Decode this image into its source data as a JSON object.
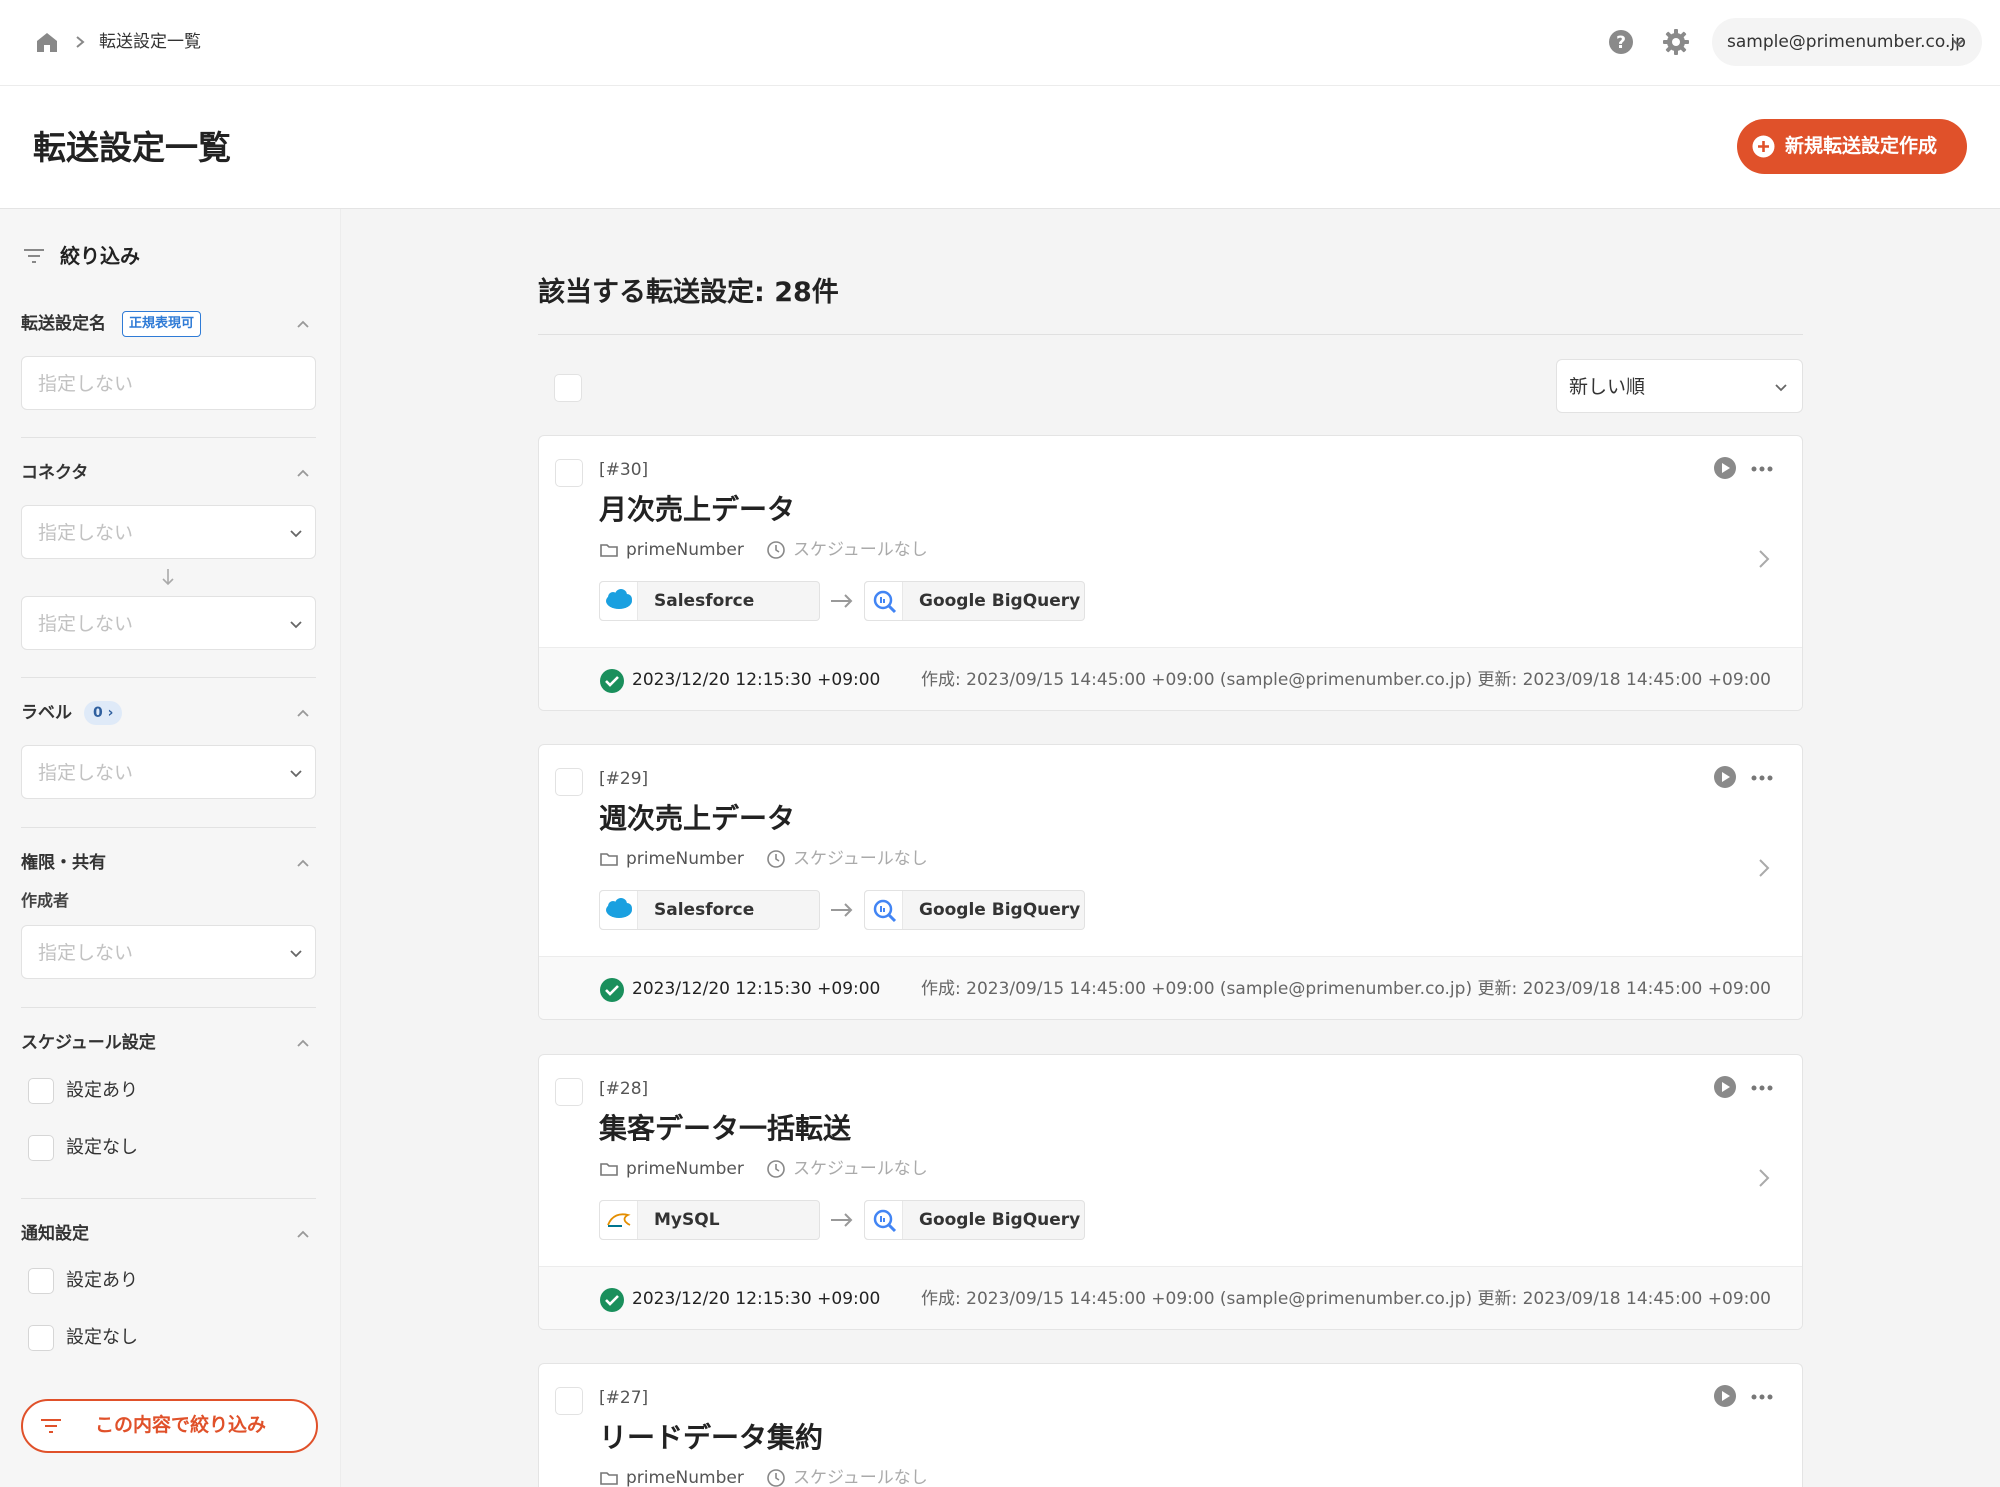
{
  "header": {
    "breadcrumb_current": "転送設定一覧",
    "account_email": "sample@primenumber.co.jp"
  },
  "page": {
    "title": "転送設定一覧",
    "create_button": "新規転送設定作成"
  },
  "sidebar": {
    "filter_label": "絞り込み",
    "sections": {
      "name": {
        "title": "転送設定名",
        "badge": "正規表現可",
        "placeholder": "指定しない"
      },
      "connector": {
        "title": "コネクタ",
        "source_value": "指定しない",
        "destination_value": "指定しない"
      },
      "label": {
        "title": "ラベル",
        "count_badge": "0 ›",
        "value": "指定しない"
      },
      "permission": {
        "title": "権限・共有",
        "creator_label": "作成者",
        "creator_value": "指定しない"
      },
      "schedule": {
        "title": "スケジュール設定",
        "option_on": "設定あり",
        "option_off": "設定なし"
      },
      "notification": {
        "title": "通知設定",
        "option_on": "設定あり",
        "option_off": "設定なし"
      }
    },
    "apply_button": "この内容で絞り込み"
  },
  "main": {
    "result_count": "該当する転送設定: 28件",
    "sort_value": "新しい順",
    "cards": [
      {
        "id": "[#30]",
        "title": "月次売上データ",
        "folder": "primeNumber",
        "schedule": "スケジュールなし",
        "source": "Salesforce",
        "source_icon": "salesforce-logo",
        "destination": "Google BigQuery",
        "destination_icon": "bigquery-logo",
        "last_run": "2023/12/20 12:15:30 +09:00",
        "meta": "作成: 2023/09/15 14:45:00 +09:00 (sample@primenumber.co.jp)   更新: 2023/09/18 14:45:00 +09:00"
      },
      {
        "id": "[#29]",
        "title": "週次売上データ",
        "folder": "primeNumber",
        "schedule": "スケジュールなし",
        "source": "Salesforce",
        "source_icon": "salesforce-logo",
        "destination": "Google BigQuery",
        "destination_icon": "bigquery-logo",
        "last_run": "2023/12/20 12:15:30 +09:00",
        "meta": "作成: 2023/09/15 14:45:00 +09:00 (sample@primenumber.co.jp)   更新: 2023/09/18 14:45:00 +09:00"
      },
      {
        "id": "[#28]",
        "title": "集客データ一括転送",
        "folder": "primeNumber",
        "schedule": "スケジュールなし",
        "source": "MySQL",
        "source_icon": "mysql-logo",
        "destination": "Google BigQuery",
        "destination_icon": "bigquery-logo",
        "last_run": "2023/12/20 12:15:30 +09:00",
        "meta": "作成: 2023/09/15 14:45:00 +09:00 (sample@primenumber.co.jp)   更新: 2023/09/18 14:45:00 +09:00"
      },
      {
        "id": "[#27]",
        "title": "リードデータ集約",
        "folder": "primeNumber",
        "schedule": "スケジュールなし"
      }
    ]
  },
  "colors": {
    "accent": "#e0512a",
    "success": "#1a8f5c",
    "link_blue": "#2f7bd6"
  }
}
